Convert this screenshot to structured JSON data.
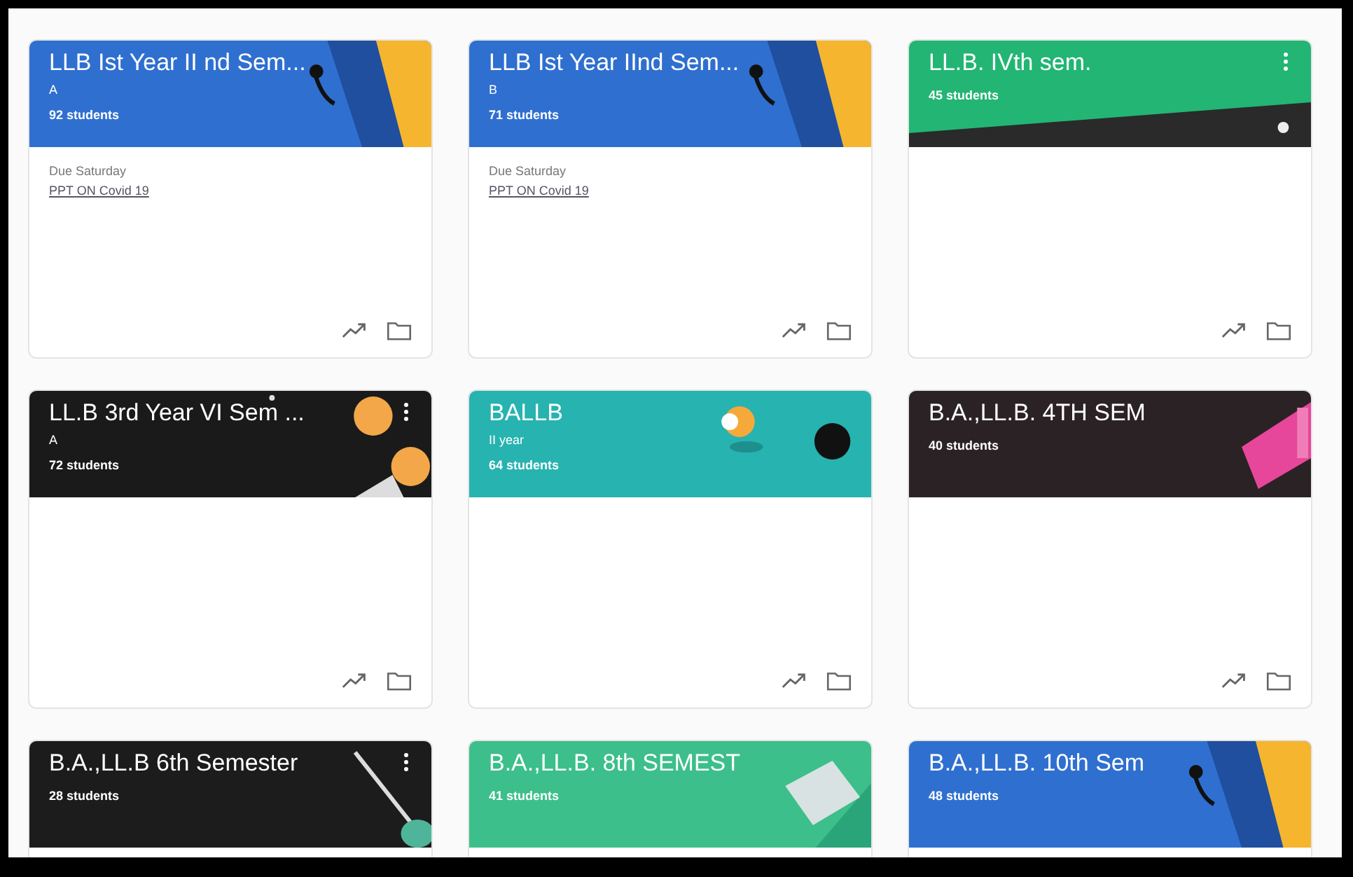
{
  "classes": [
    {
      "title": "LLB Ist Year II nd Sem...",
      "section": "A",
      "students": "92 students",
      "color": "#2f6fd0",
      "kind": "headphones",
      "menu_icon": false,
      "due": "Due Saturday",
      "assignment": "PPT ON Covid 19",
      "show_actions": true
    },
    {
      "title": "LLB Ist Year IInd Sem...",
      "section": "B",
      "students": "71 students",
      "color": "#2f6fd0",
      "kind": "headphones",
      "menu_icon": false,
      "due": "Due Saturday",
      "assignment": "PPT ON Covid 19",
      "show_actions": true
    },
    {
      "title": "LL.B. IVth sem.",
      "students": "45 students",
      "color": "#22b574",
      "kind": "hill",
      "menu_icon": true,
      "show_actions": true
    },
    {
      "title": "LL.B 3rd Year VI Sem ...",
      "section": "A",
      "students": "72 students",
      "color": "#1a1a1a",
      "kind": "balls",
      "menu_icon": true,
      "show_actions": true
    },
    {
      "title": "BALLB",
      "section": "II year",
      "students": "64 students",
      "color": "#27b3b0",
      "kind": "pool",
      "menu_icon": false,
      "show_actions": true
    },
    {
      "title": "B.A.,LL.B. 4TH SEM",
      "students": "40 students",
      "color": "#2b2226",
      "kind": "tag",
      "menu_icon": false,
      "show_actions": true
    },
    {
      "title": "B.A.,LL.B 6th Semester",
      "students": "28 students",
      "color": "#1c1c1c",
      "kind": "guitar",
      "menu_icon": true
    },
    {
      "title": "B.A.,LL.B. 8th SEMEST",
      "students": "41 students",
      "color": "#3cbf8a",
      "kind": "book",
      "menu_icon": false
    },
    {
      "title": "B.A.,LL.B. 10th Sem",
      "students": "48 students",
      "color": "#2f6fd0",
      "kind": "headphones",
      "menu_icon": false
    }
  ]
}
